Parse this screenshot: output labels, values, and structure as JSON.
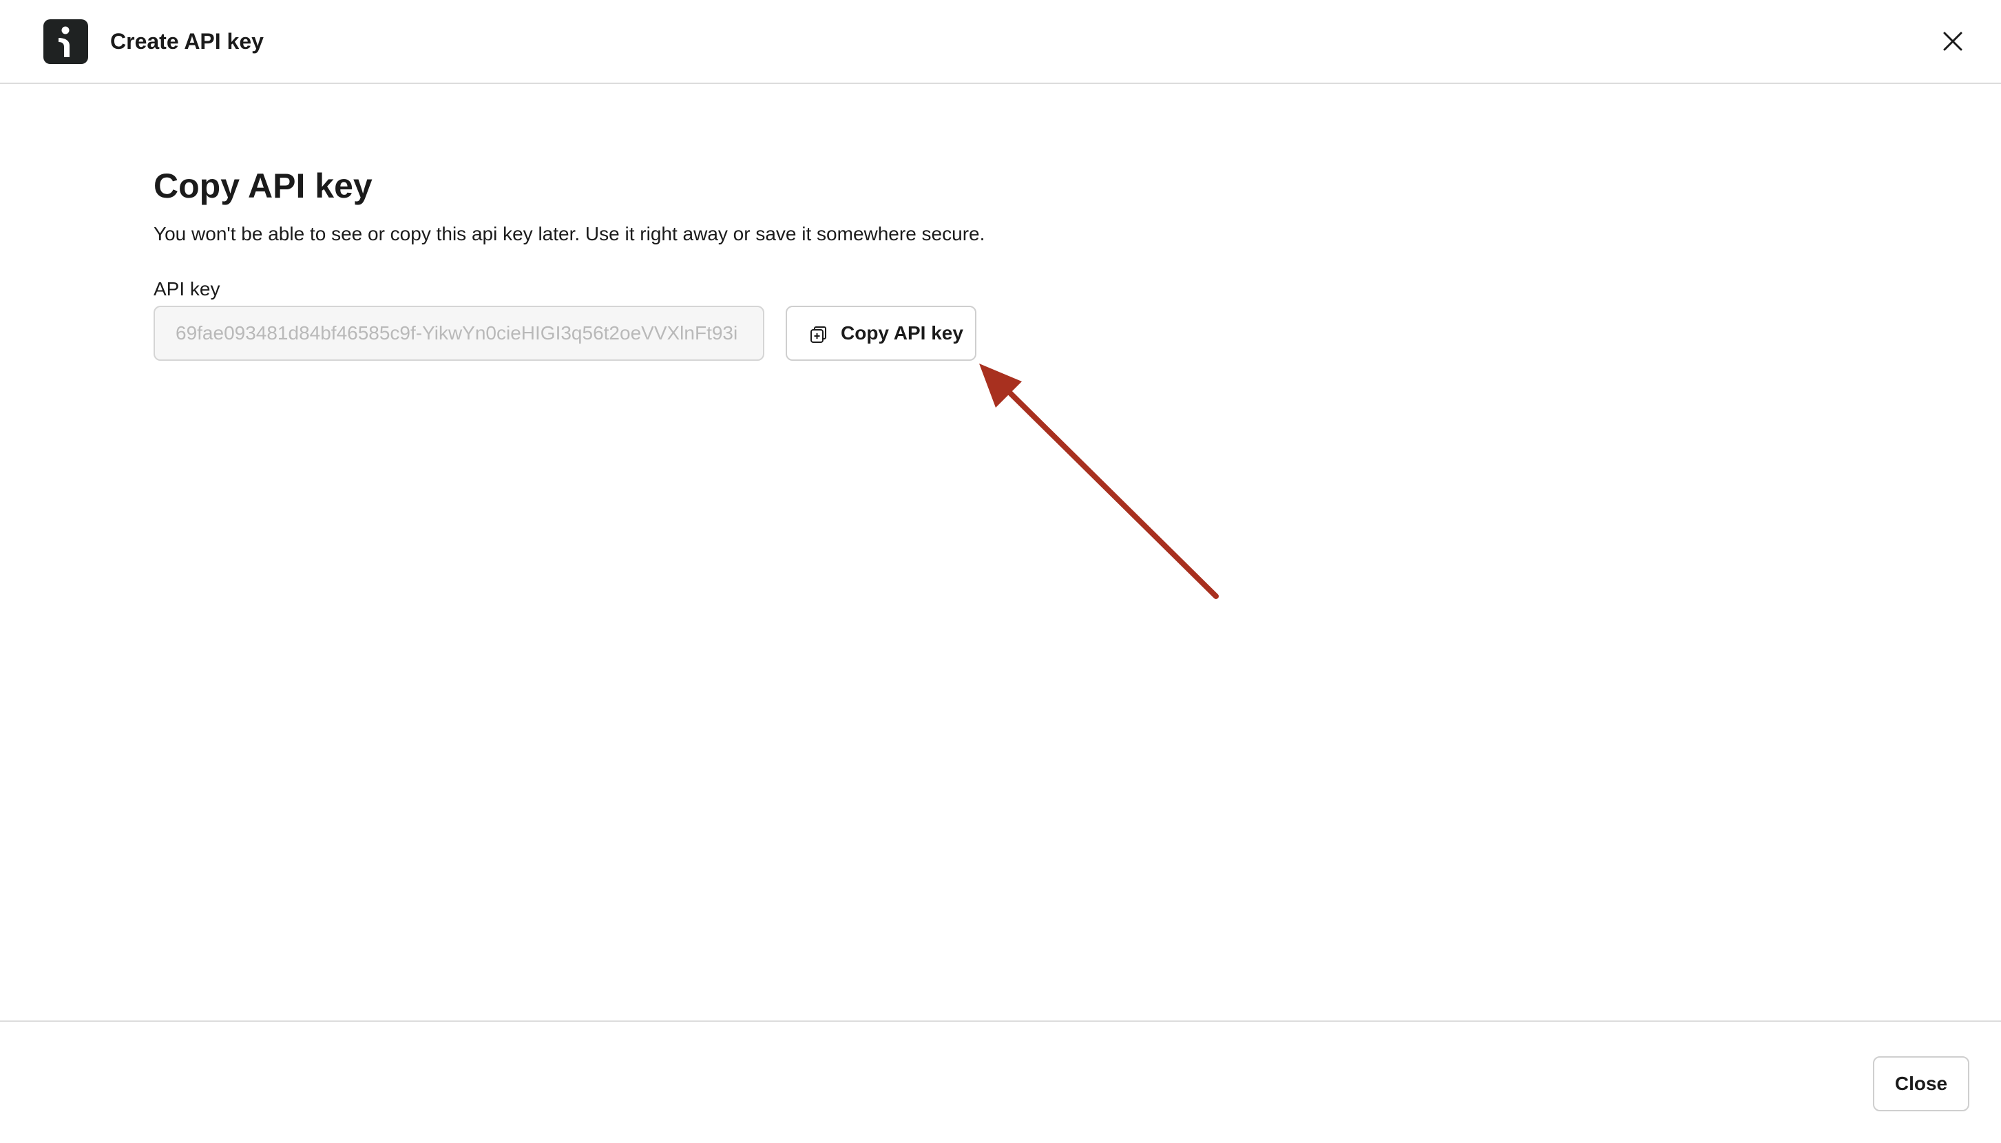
{
  "header": {
    "title": "Create API key",
    "logo_icon": "brand-logo-icon",
    "close_icon": "close-icon"
  },
  "main": {
    "heading": "Copy API key",
    "description": "You won't be able to see or copy this api key later. Use it right away or save it somewhere secure.",
    "api_key_label": "API key",
    "api_key_value": "69fae093481d84bf46585c9f-YikwYn0cieHIGI3q56t2oeVVXlnFt93i",
    "copy_button_label": "Copy API key",
    "copy_icon": "copy-icon"
  },
  "annotation": {
    "type": "arrow",
    "color": "#a8301f"
  },
  "footer": {
    "close_button_label": "Close"
  },
  "colors": {
    "text": "#1b1b1b",
    "border": "#d5d5d5",
    "input_bg": "#f6f6f6",
    "input_text": "#b9b9b9",
    "logo_bg": "#1f2222",
    "arrow": "#a8301f"
  }
}
